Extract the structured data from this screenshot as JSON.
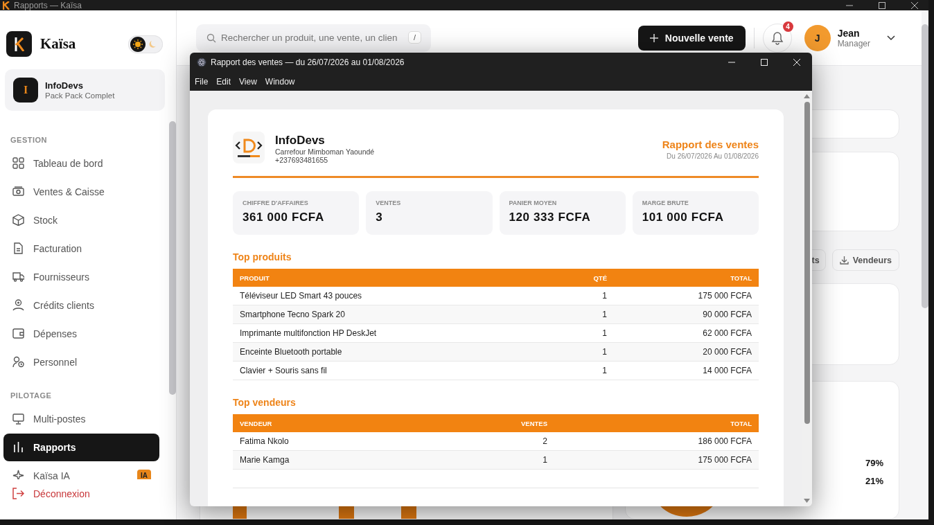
{
  "app_window": {
    "title": "Rapports — Kaïsa"
  },
  "sidebar": {
    "brand": "Kaïsa",
    "theme": {
      "dark": false
    },
    "organization": {
      "initial": "I",
      "name": "InfoDevs",
      "plan": "Pack Pack Complet"
    },
    "sections": [
      {
        "title": "GESTION",
        "items": [
          {
            "label": "Tableau de bord",
            "selected": false
          },
          {
            "label": "Ventes & Caisse",
            "selected": false
          },
          {
            "label": "Stock",
            "selected": false
          },
          {
            "label": "Facturation",
            "selected": false
          },
          {
            "label": "Fournisseurs",
            "selected": false
          },
          {
            "label": "Crédits clients",
            "selected": false
          },
          {
            "label": "Dépenses",
            "selected": false
          },
          {
            "label": "Personnel",
            "selected": false
          }
        ]
      },
      {
        "title": "PILOTAGE",
        "items": [
          {
            "label": "Multi-postes",
            "selected": false
          },
          {
            "label": "Rapports",
            "selected": true
          },
          {
            "label": "Kaïsa IA",
            "selected": false,
            "badge": "IA"
          }
        ]
      }
    ],
    "logout": "Déconnexion"
  },
  "header": {
    "search": {
      "placeholder": "Rechercher un produit, une vente, un clien",
      "shortcut": "/"
    },
    "new_sale_button": "Nouvelle vente",
    "notifications": {
      "count": "4"
    },
    "user": {
      "initial": "J",
      "name": "Jean",
      "role": "Manager"
    }
  },
  "background_panel": {
    "export_buttons": [
      "ts",
      "Vendeurs"
    ],
    "shares": [
      "79%",
      "21%"
    ]
  },
  "report_window": {
    "title": "Rapport des ventes — du 26/07/2026 au 01/08/2026",
    "menu": [
      "File",
      "Edit",
      "View",
      "Window"
    ],
    "company": {
      "name": "InfoDevs",
      "address": "Carrefour Mimboman Yaoundé",
      "phone": "+237693481655"
    },
    "report_title": "Rapport des ventes",
    "period": "Du 26/07/2026 Au 01/08/2026",
    "kpis": [
      {
        "label": "CHIFFRE D'AFFAIRES",
        "value": "361 000 FCFA"
      },
      {
        "label": "VENTES",
        "value": "3"
      },
      {
        "label": "PANIER MOYEN",
        "value": "120 333 FCFA"
      },
      {
        "label": "MARGE BRUTE",
        "value": "101 000 FCFA"
      }
    ],
    "top_products": {
      "title": "Top produits",
      "columns": [
        "PRODUIT",
        "QTÉ",
        "TOTAL"
      ],
      "rows": [
        [
          "Téléviseur LED Smart 43 pouces",
          "1",
          "175 000 FCFA"
        ],
        [
          "Smartphone Tecno Spark 20",
          "1",
          "90 000 FCFA"
        ],
        [
          "Imprimante multifonction HP DeskJet",
          "1",
          "62 000 FCFA"
        ],
        [
          "Enceinte Bluetooth portable",
          "1",
          "20 000 FCFA"
        ],
        [
          "Clavier + Souris sans fil",
          "1",
          "14 000 FCFA"
        ]
      ]
    },
    "top_sellers": {
      "title": "Top vendeurs",
      "columns": [
        "VENDEUR",
        "VENTES",
        "TOTAL"
      ],
      "rows": [
        [
          "Fatima Nkolo",
          "2",
          "186 000 FCFA"
        ],
        [
          "Marie Kamga",
          "1",
          "175 000 FCFA"
        ]
      ]
    }
  }
}
